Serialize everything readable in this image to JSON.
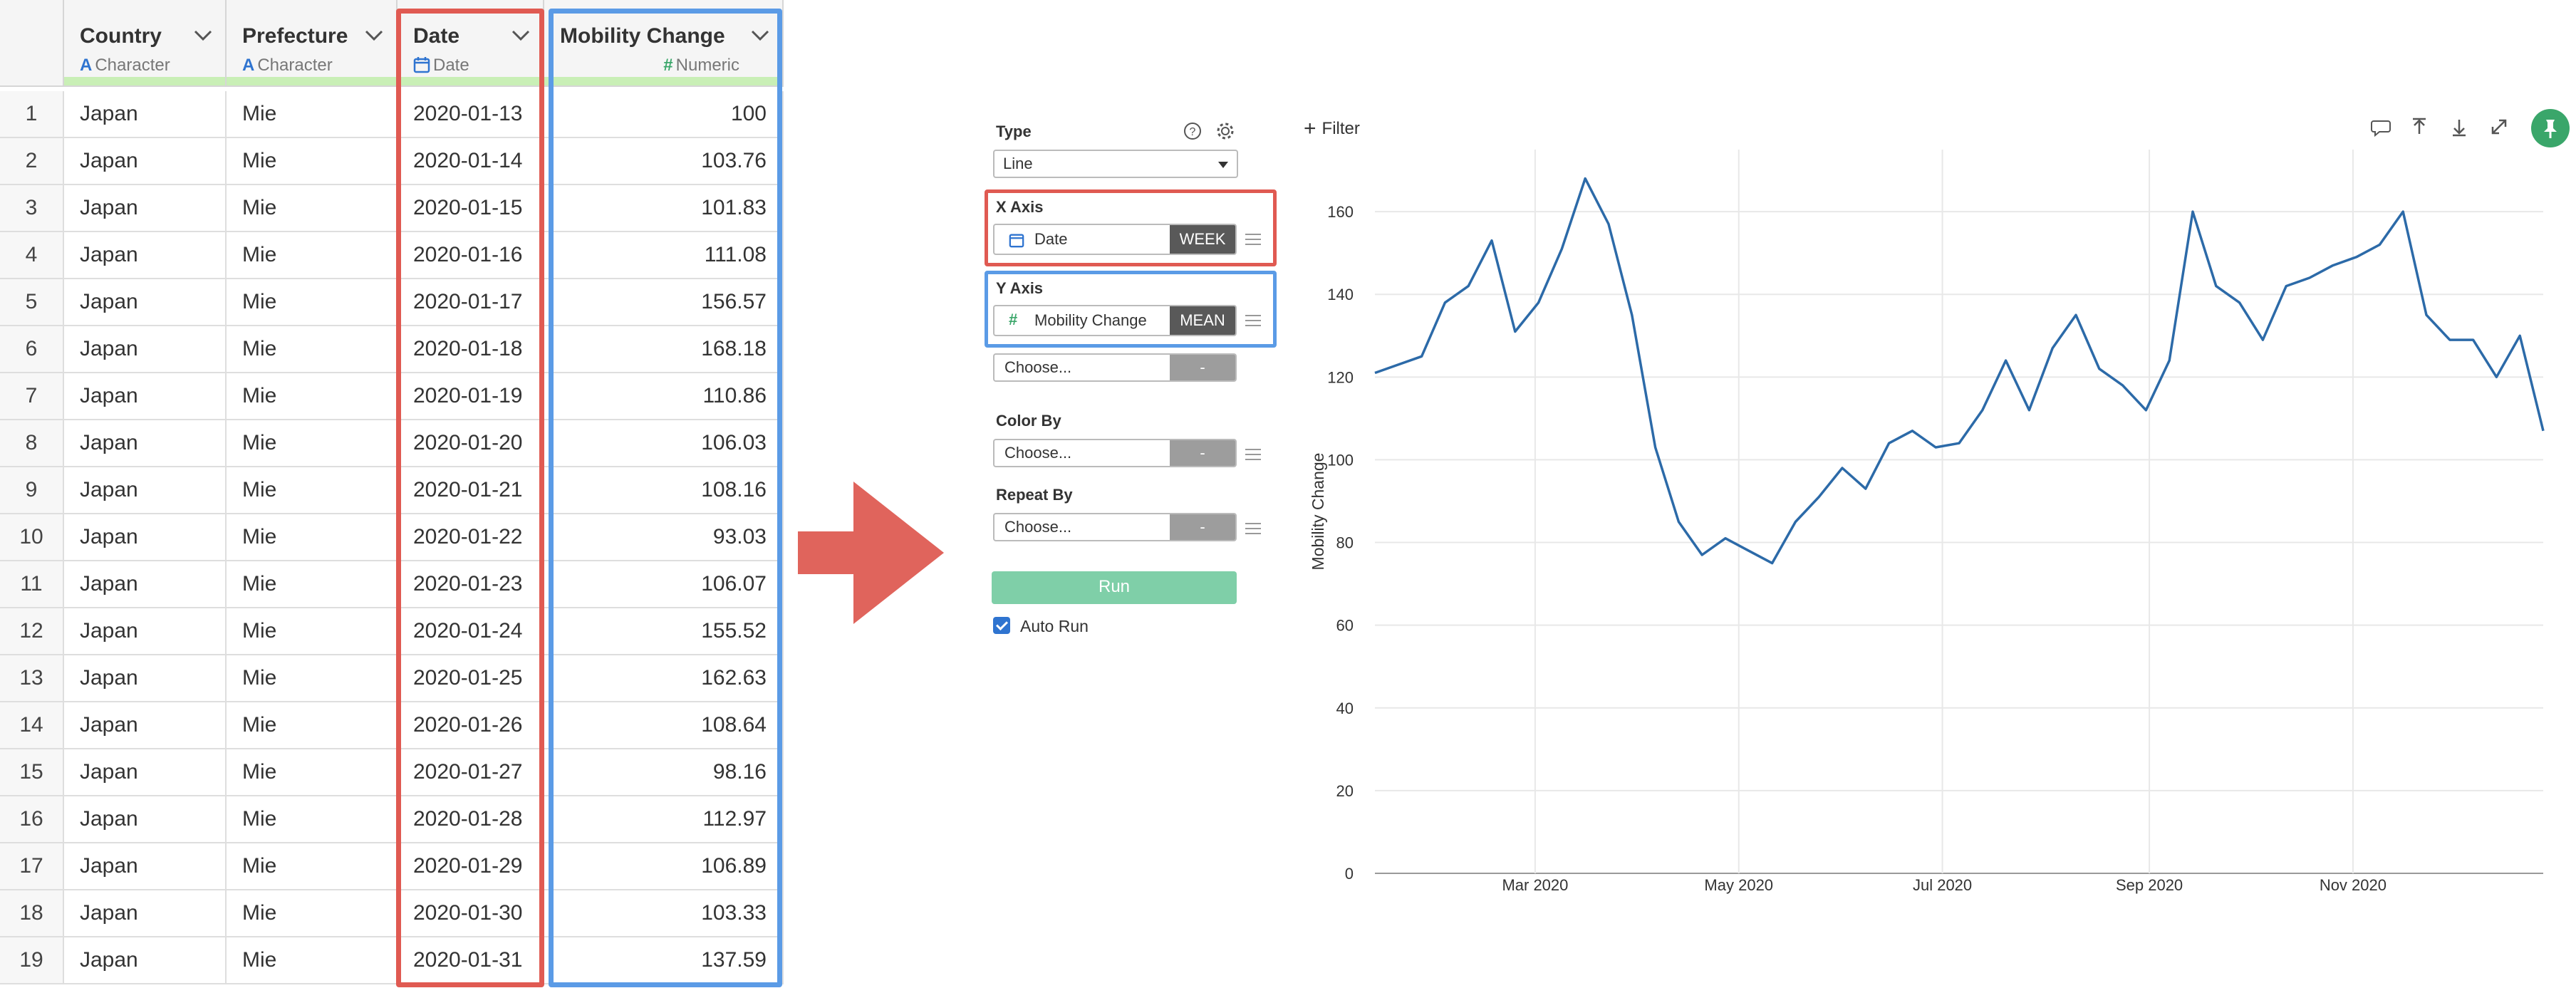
{
  "table": {
    "columns": [
      {
        "name": "Country",
        "type_label": "Character",
        "type_icon": "A"
      },
      {
        "name": "Prefecture",
        "type_label": "Character",
        "type_icon": "A"
      },
      {
        "name": "Date",
        "type_label": "Date",
        "type_icon": "calendar-icon"
      },
      {
        "name": "Mobility Change",
        "type_label": "Numeric",
        "type_icon": "#"
      }
    ],
    "rows": [
      {
        "idx": "1",
        "country": "Japan",
        "prefecture": "Mie",
        "date": "2020-01-13",
        "value": "100"
      },
      {
        "idx": "2",
        "country": "Japan",
        "prefecture": "Mie",
        "date": "2020-01-14",
        "value": "103.76"
      },
      {
        "idx": "3",
        "country": "Japan",
        "prefecture": "Mie",
        "date": "2020-01-15",
        "value": "101.83"
      },
      {
        "idx": "4",
        "country": "Japan",
        "prefecture": "Mie",
        "date": "2020-01-16",
        "value": "111.08"
      },
      {
        "idx": "5",
        "country": "Japan",
        "prefecture": "Mie",
        "date": "2020-01-17",
        "value": "156.57"
      },
      {
        "idx": "6",
        "country": "Japan",
        "prefecture": "Mie",
        "date": "2020-01-18",
        "value": "168.18"
      },
      {
        "idx": "7",
        "country": "Japan",
        "prefecture": "Mie",
        "date": "2020-01-19",
        "value": "110.86"
      },
      {
        "idx": "8",
        "country": "Japan",
        "prefecture": "Mie",
        "date": "2020-01-20",
        "value": "106.03"
      },
      {
        "idx": "9",
        "country": "Japan",
        "prefecture": "Mie",
        "date": "2020-01-21",
        "value": "108.16"
      },
      {
        "idx": "10",
        "country": "Japan",
        "prefecture": "Mie",
        "date": "2020-01-22",
        "value": "93.03"
      },
      {
        "idx": "11",
        "country": "Japan",
        "prefecture": "Mie",
        "date": "2020-01-23",
        "value": "106.07"
      },
      {
        "idx": "12",
        "country": "Japan",
        "prefecture": "Mie",
        "date": "2020-01-24",
        "value": "155.52"
      },
      {
        "idx": "13",
        "country": "Japan",
        "prefecture": "Mie",
        "date": "2020-01-25",
        "value": "162.63"
      },
      {
        "idx": "14",
        "country": "Japan",
        "prefecture": "Mie",
        "date": "2020-01-26",
        "value": "108.64"
      },
      {
        "idx": "15",
        "country": "Japan",
        "prefecture": "Mie",
        "date": "2020-01-27",
        "value": "98.16"
      },
      {
        "idx": "16",
        "country": "Japan",
        "prefecture": "Mie",
        "date": "2020-01-28",
        "value": "112.97"
      },
      {
        "idx": "17",
        "country": "Japan",
        "prefecture": "Mie",
        "date": "2020-01-29",
        "value": "106.89"
      },
      {
        "idx": "18",
        "country": "Japan",
        "prefecture": "Mie",
        "date": "2020-01-30",
        "value": "103.33"
      },
      {
        "idx": "19",
        "country": "Japan",
        "prefecture": "Mie",
        "date": "2020-01-31",
        "value": "137.59"
      }
    ]
  },
  "config": {
    "type_label": "Type",
    "type_value": "Line",
    "x_axis_label": "X Axis",
    "x_field": "Date",
    "x_agg": "WEEK",
    "y_axis_label": "Y Axis",
    "y_field": "Mobility Change",
    "y_agg": "MEAN",
    "choose_placeholder": "Choose...",
    "dash": "-",
    "color_by_label": "Color By",
    "repeat_by_label": "Repeat By",
    "run_label": "Run",
    "auto_run_label": "Auto Run",
    "auto_run_checked": true
  },
  "toolbar": {
    "filter_label": "Filter"
  },
  "colors": {
    "highlight_red": "#e05a52",
    "highlight_blue": "#5b9be6",
    "line": "#2c6aa8",
    "arrow": "#e0645c",
    "run": "#7fcfa8",
    "pin": "#3aa66a"
  },
  "chart_data": {
    "type": "line",
    "title": "",
    "xlabel": "",
    "ylabel": "Mobility Change",
    "ylim": [
      0,
      175
    ],
    "y_ticks": [
      0,
      20,
      40,
      60,
      80,
      100,
      120,
      140,
      160
    ],
    "x_tick_labels": [
      {
        "label": "Mar 2020",
        "date": "2020-03-01"
      },
      {
        "label": "May 2020",
        "date": "2020-05-01"
      },
      {
        "label": "Jul 2020",
        "date": "2020-07-01"
      },
      {
        "label": "Sep 2020",
        "date": "2020-09-01"
      },
      {
        "label": "Nov 2020",
        "date": "2020-11-01"
      }
    ],
    "xlim": [
      "2020-01-13",
      "2020-12-28"
    ],
    "grid": true,
    "series": [
      {
        "x": [
          "2020-01-13",
          "2020-01-20",
          "2020-01-27",
          "2020-02-03",
          "2020-02-10",
          "2020-02-17",
          "2020-02-24",
          "2020-03-02",
          "2020-03-09",
          "2020-03-16",
          "2020-03-23",
          "2020-03-30",
          "2020-04-06",
          "2020-04-13",
          "2020-04-20",
          "2020-04-27",
          "2020-05-04",
          "2020-05-11",
          "2020-05-18",
          "2020-05-25",
          "2020-06-01",
          "2020-06-08",
          "2020-06-15",
          "2020-06-22",
          "2020-06-29",
          "2020-07-06",
          "2020-07-13",
          "2020-07-20",
          "2020-07-27",
          "2020-08-03",
          "2020-08-10",
          "2020-08-17",
          "2020-08-24",
          "2020-08-31",
          "2020-09-07",
          "2020-09-14",
          "2020-09-21",
          "2020-09-28",
          "2020-10-05",
          "2020-10-12",
          "2020-10-19",
          "2020-10-26",
          "2020-11-02",
          "2020-11-09",
          "2020-11-16",
          "2020-11-23",
          "2020-11-30",
          "2020-12-07",
          "2020-12-14",
          "2020-12-21",
          "2020-12-28"
        ],
        "values": [
          121,
          123,
          125,
          138,
          142,
          153,
          131,
          138,
          151,
          168,
          157,
          135,
          103,
          85,
          77,
          81,
          78,
          75,
          85,
          91,
          98,
          93,
          104,
          107,
          103,
          104,
          112,
          124,
          112,
          127,
          135,
          122,
          118,
          112,
          124,
          160,
          142,
          138,
          129,
          142,
          144,
          147,
          149,
          152,
          160,
          135,
          129,
          129,
          120,
          130,
          107
        ]
      }
    ]
  }
}
